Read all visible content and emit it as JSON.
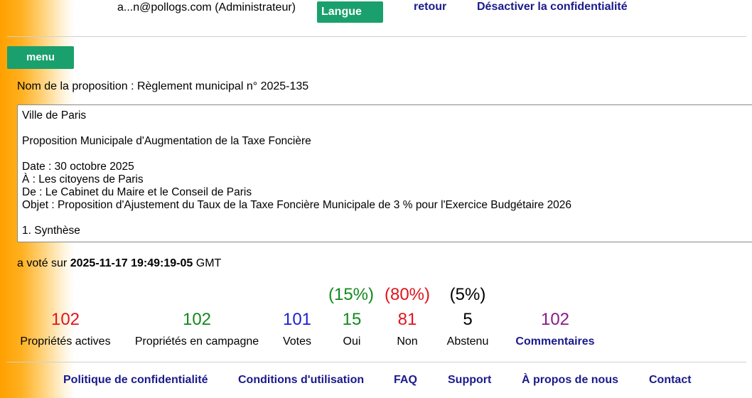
{
  "header": {
    "user": "a...n@pollogs.com (Administrateur)",
    "language_button": "Langue",
    "back_link": "retour",
    "privacy_toggle_link": "Désactiver la confidentialité"
  },
  "menu_button": "menu",
  "proposal": {
    "name_label": "Nom de la proposition : Règlement municipal n° 2025-135",
    "text": "Ville de Paris\n\nProposition Municipale d'Augmentation de la Taxe Foncière\n\nDate : 30 octobre 2025\nÀ : Les citoyens de Paris\nDe : Le Cabinet du Maire et le Conseil de Paris\nObjet : Proposition d'Ajustement du Taux de la Taxe Foncière Municipale de 3 % pour l'Exercice Budgétaire 2026\n\n1. Synthèse"
  },
  "vote_info": {
    "prefix": "a voté sur",
    "datetime": "2025-11-17 19:49:19-05",
    "timezone": "GMT"
  },
  "stats": {
    "active_properties": {
      "value": "102",
      "label": "Propriétés actives"
    },
    "campaign_properties": {
      "value": "102",
      "label": "Propriétés en campagne"
    },
    "votes": {
      "value": "101",
      "label": "Votes"
    },
    "yes": {
      "value": "15",
      "label": "Oui",
      "percent": "(15%)"
    },
    "no": {
      "value": "81",
      "label": "Non",
      "percent": "(80%)"
    },
    "abstain": {
      "value": "5",
      "label": "Abstenu",
      "percent": "(5%)"
    },
    "comments": {
      "value": "102",
      "label": "Commentaires"
    }
  },
  "colors": {
    "button_green": "#1aa06d",
    "link_navy": "#1a1a8c",
    "red": "#e0141e",
    "green": "#128a1c",
    "blue": "#1f1fd0",
    "purple": "#8a1a8a"
  },
  "footer": {
    "privacy": "Politique de confidentialité",
    "terms": "Conditions d'utilisation",
    "faq": "FAQ",
    "support": "Support",
    "about": "À propos de nous",
    "contact": "Contact"
  }
}
